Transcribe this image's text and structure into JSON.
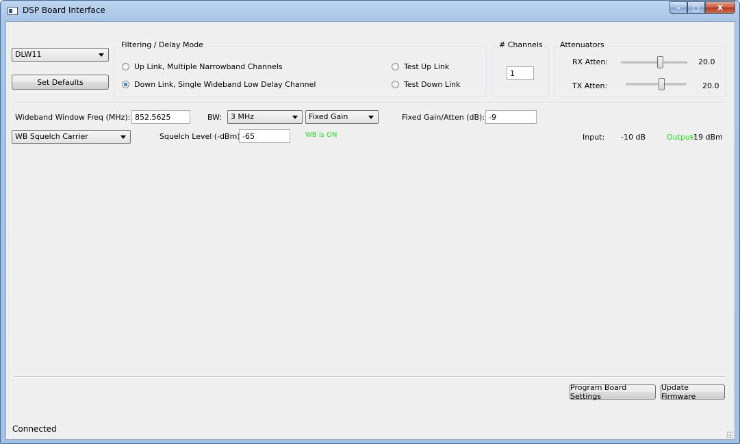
{
  "window": {
    "title": "DSP Board Interface",
    "minimize": "–",
    "maximize": "□",
    "close": "X"
  },
  "board": {
    "selected": "DLW11",
    "set_defaults": "Set Defaults"
  },
  "filter_mode": {
    "title": "Filtering / Delay Mode",
    "options": [
      {
        "label": "Up Link, Multiple Narrowband Channels",
        "selected": false
      },
      {
        "label": "Down Link, Single Wideband Low Delay Channel",
        "selected": true
      },
      {
        "label": "Test Up Link",
        "selected": false
      },
      {
        "label": "Test Down Link",
        "selected": false
      }
    ]
  },
  "channels": {
    "title": "# Channels",
    "value": "1"
  },
  "attenuators": {
    "title": "Attenuators",
    "rx": {
      "label": "RX Atten:",
      "value": "20.0",
      "level": 0.6
    },
    "tx": {
      "label": "TX Atten:",
      "value": "20.0",
      "level": 0.6
    }
  },
  "wideband": {
    "freq_label": "Wideband Window Freq (MHz):",
    "freq_value": "852.5625",
    "bw_label": "BW:",
    "bw_value": "3 MHz",
    "gain_mode": "Fixed Gain",
    "gain_label": "Fixed Gain/Atten (dB):",
    "gain_value": "-9"
  },
  "squelch": {
    "mode": "WB Squelch Carrier",
    "level_label": "Squelch Level (-dBm):",
    "level_value": "-65",
    "status": "WB is ON"
  },
  "levels": {
    "input_label": "Input:",
    "input_value": "-10 dB",
    "output_label": "Output:",
    "output_value": "-19 dBm"
  },
  "actions": {
    "program": "Program Board Settings",
    "update": "Update Firmware"
  },
  "statusbar": {
    "text": "Connected"
  },
  "colors": {
    "status_green": "#22dd22",
    "title_gradient": "#bcd5ef"
  }
}
